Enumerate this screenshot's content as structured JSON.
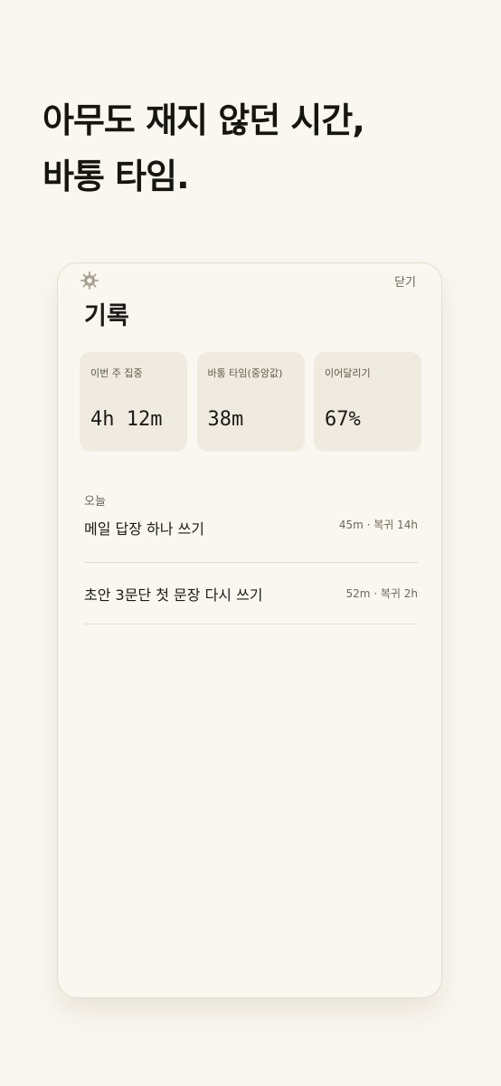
{
  "headline": {
    "line1": "아무도 재지 않던 시간,",
    "line2": "바통 타임."
  },
  "screen": {
    "title": "기록",
    "close_label": "닫기",
    "settings_icon": "gear-icon"
  },
  "stats": [
    {
      "label": "이번 주 집중",
      "value": "4h 12m"
    },
    {
      "label": "바통 타임(중앙값)",
      "value": "38m"
    },
    {
      "label": "이어달리기",
      "value": "67%"
    }
  ],
  "today": {
    "label": "오늘",
    "items": [
      {
        "title": "메일 답장 하나 쓰기",
        "meta": "45m · 복귀 14h"
      },
      {
        "title": "초안 3문단 첫 문장 다시 쓰기",
        "meta": "52m · 복귀 2h"
      }
    ]
  },
  "colors": {
    "background": "#faf7f1",
    "card": "#f0ebe0",
    "border": "#e4ddcc",
    "text": "#1c1a16",
    "muted": "#6d6658"
  }
}
